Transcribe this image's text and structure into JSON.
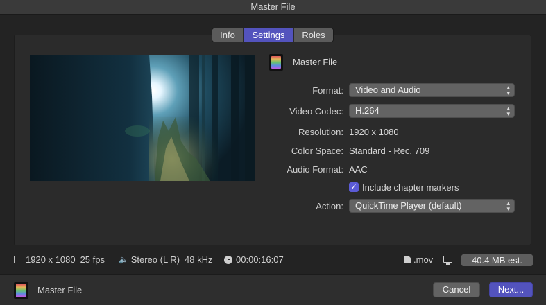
{
  "window": {
    "title": "Master File"
  },
  "tabs": [
    {
      "label": "Info",
      "active": false
    },
    {
      "label": "Settings",
      "active": true
    },
    {
      "label": "Roles",
      "active": false
    }
  ],
  "header": {
    "title": "Master File",
    "icon": "film-strip-icon"
  },
  "settings": {
    "format": {
      "label": "Format:",
      "value": "Video and Audio"
    },
    "video_codec": {
      "label": "Video Codec:",
      "value": "H.264"
    },
    "resolution": {
      "label": "Resolution:",
      "value": "1920 x 1080"
    },
    "color_space": {
      "label": "Color Space:",
      "value": "Standard - Rec. 709"
    },
    "audio_format": {
      "label": "Audio Format:",
      "value": "AAC"
    },
    "chapter_markers": {
      "label": "Include chapter markers",
      "checked": true
    },
    "action": {
      "label": "Action:",
      "value": "QuickTime Player (default)"
    }
  },
  "info_bar": {
    "resolution": "1920 x 1080",
    "fps": "25 fps",
    "audio_channels": "Stereo (L R)",
    "sample_rate": "48 kHz",
    "duration": "00:00:16:07",
    "extension": ".mov",
    "size_estimate": "40.4 MB est."
  },
  "footer": {
    "title": "Master File",
    "cancel_label": "Cancel",
    "next_label": "Next..."
  },
  "colors": {
    "accent": "#5353bd",
    "background": "#232323",
    "panel": "#2b2b2b",
    "control": "#636363"
  }
}
